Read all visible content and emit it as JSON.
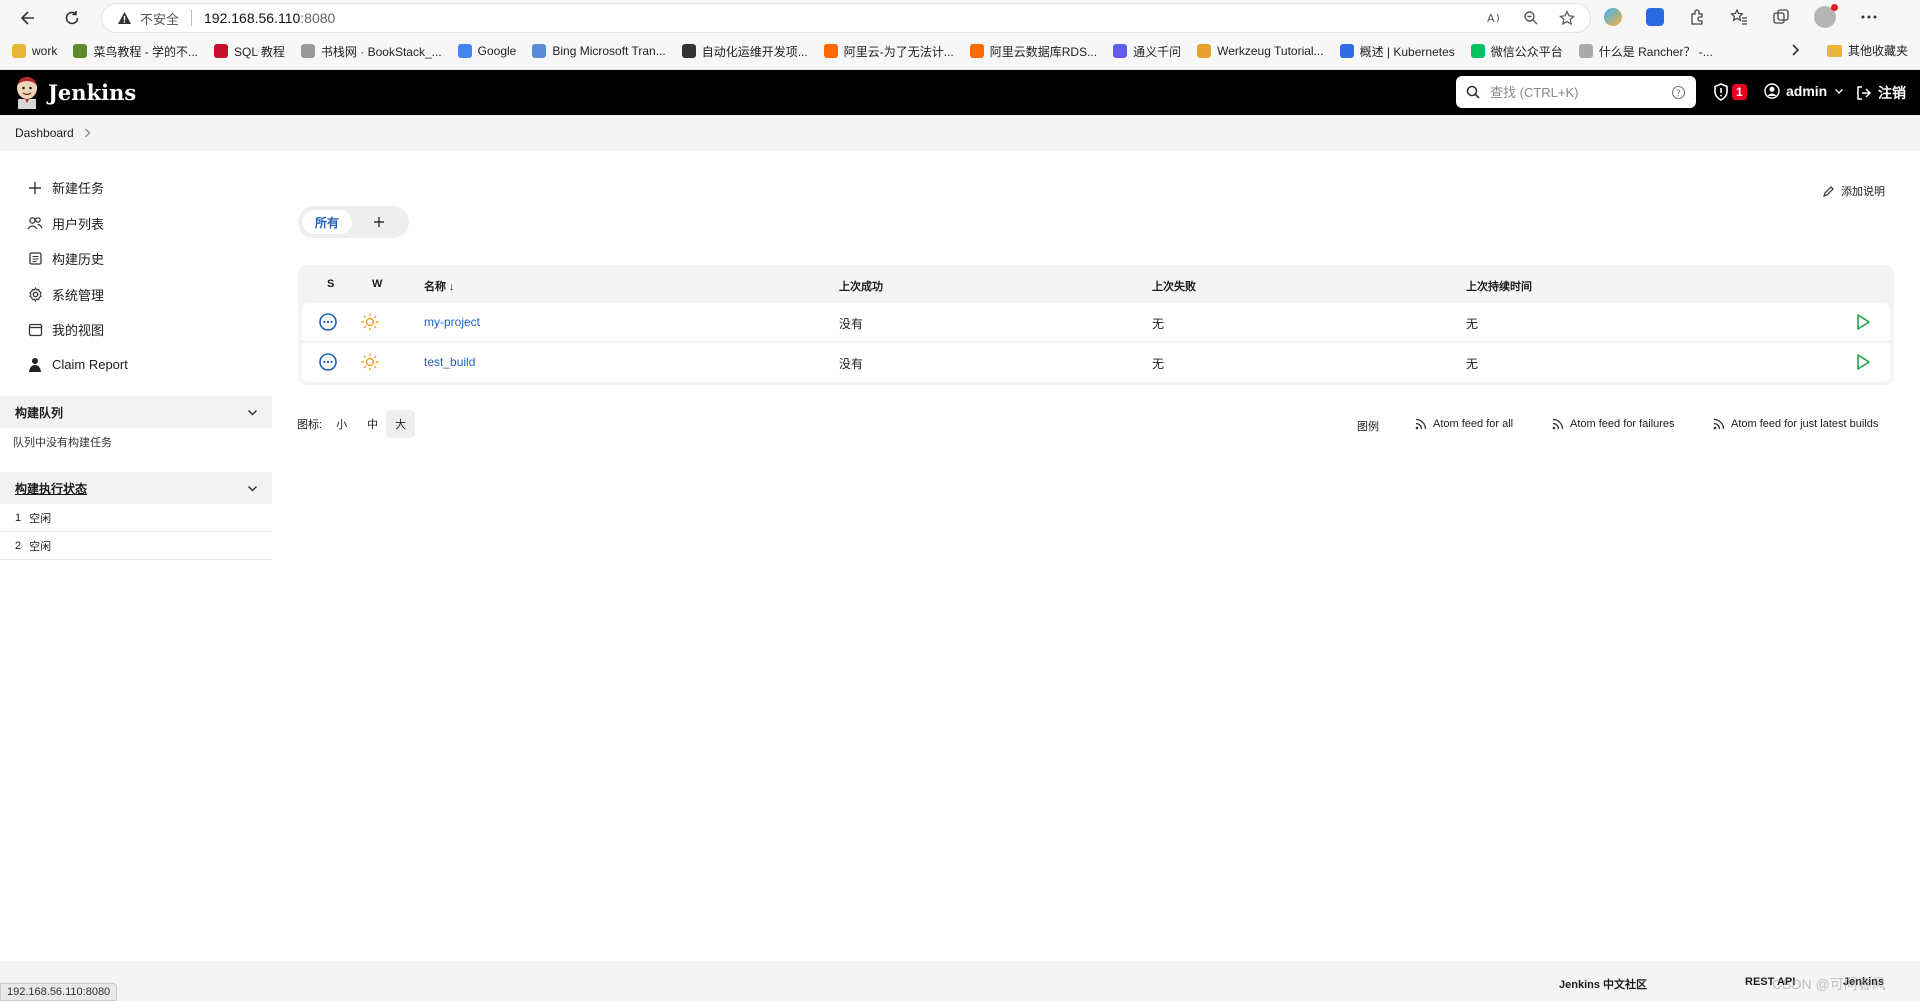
{
  "browser": {
    "security_label": "不安全",
    "url_host": "192.168.56.110",
    "url_port": ":8080",
    "bookmarks": [
      {
        "label": "work",
        "color": "#e8b73a"
      },
      {
        "label": "菜鸟教程 - 学的不...",
        "color": "#5a8a2a"
      },
      {
        "label": "SQL 教程",
        "color": "#c8102e"
      },
      {
        "label": "书栈网 · BookStack_...",
        "color": "#999999"
      },
      {
        "label": "Google",
        "color": "#4285f4"
      },
      {
        "label": "Bing Microsoft Tran...",
        "color": "#5b8bd8"
      },
      {
        "label": "自动化运维开发项...",
        "color": "#333333"
      },
      {
        "label": "阿里云-为了无法计...",
        "color": "#ff6a00"
      },
      {
        "label": "阿里云数据库RDS...",
        "color": "#ff6a00"
      },
      {
        "label": "通义千问",
        "color": "#615ced"
      },
      {
        "label": "Werkzeug Tutorial...",
        "color": "#e8a030"
      },
      {
        "label": "概述 | Kubernetes",
        "color": "#326ce5"
      },
      {
        "label": "微信公众平台",
        "color": "#07c160"
      },
      {
        "label": "什么是 Rancher？ -...",
        "color": "#aaaaaa"
      }
    ],
    "bookmarks_folder": "其他收藏夹"
  },
  "header": {
    "title": "Jenkins",
    "search_placeholder": "查找 (CTRL+K)",
    "alert_count": "1",
    "username": "admin",
    "logout_label": "注销"
  },
  "breadcrumb": {
    "root": "Dashboard"
  },
  "sidebar": {
    "tasks": [
      {
        "label": "新建任务",
        "icon": "plus-icon"
      },
      {
        "label": "用户列表",
        "icon": "users-icon"
      },
      {
        "label": "构建历史",
        "icon": "history-icon"
      },
      {
        "label": "系统管理",
        "icon": "gear-icon"
      },
      {
        "label": "我的视图",
        "icon": "window-icon"
      },
      {
        "label": "Claim Report",
        "icon": "person-icon"
      }
    ],
    "build_queue": {
      "title": "构建队列",
      "empty_text": "队列中没有构建任务"
    },
    "executors": {
      "title": "构建执行状态",
      "rows": [
        {
          "num": "1",
          "status": "空闲"
        },
        {
          "num": "2",
          "status": "空闲"
        }
      ]
    }
  },
  "main": {
    "add_description": "添加说明",
    "tabs": {
      "all": "所有",
      "add": "+"
    },
    "table": {
      "headers": {
        "s": "S",
        "w": "W",
        "name": "名称 ↓",
        "last_success": "上次成功",
        "last_failure": "上次失败",
        "last_duration": "上次持续时间"
      },
      "rows": [
        {
          "name": "my-project",
          "last_success": "没有",
          "last_failure": "无",
          "last_duration": "无"
        },
        {
          "name": "test_build",
          "last_success": "没有",
          "last_failure": "无",
          "last_duration": "无"
        }
      ]
    },
    "icon_size": {
      "label": "图标:",
      "small": "小",
      "medium": "中",
      "large": "大"
    },
    "legend": "图例",
    "feeds": {
      "all": "Atom feed for all",
      "failures": "Atom feed for failures",
      "latest": "Atom feed for just latest builds"
    }
  },
  "footer": {
    "community": "Jenkins 中文社区",
    "rest_api": "REST API",
    "version": "Jenkins"
  },
  "statusbar": {
    "url": "192.168.56.110:8080"
  },
  "watermark": "CSDN @可问春风"
}
